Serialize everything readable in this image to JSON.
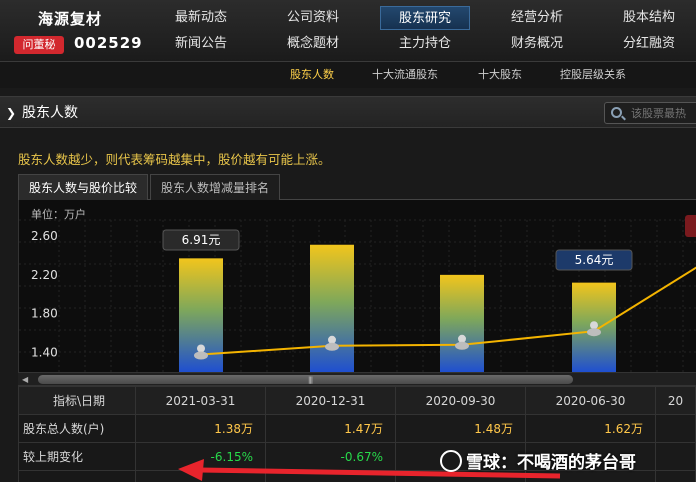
{
  "brand": {
    "name": "海源复材",
    "ask_label": "问董秘",
    "code": "002529"
  },
  "nav": [
    {
      "label": "最新动态"
    },
    {
      "label": "公司资料"
    },
    {
      "label": "股东研究"
    },
    {
      "label": "经营分析"
    },
    {
      "label": "股本结构"
    },
    {
      "label": "新闻公告"
    },
    {
      "label": "概念题材"
    },
    {
      "label": "主力持仓"
    },
    {
      "label": "财务概况"
    },
    {
      "label": "分红融资"
    }
  ],
  "subnav": [
    {
      "label": "股东人数"
    },
    {
      "label": "十大流通股东"
    },
    {
      "label": "十大股东"
    },
    {
      "label": "控股层级关系"
    }
  ],
  "section": {
    "title": "股东人数",
    "search_placeholder": "该股票最热"
  },
  "hint": "股东人数越少，则代表筹码越集中，股价越有可能上涨。",
  "tabs": [
    {
      "label": "股东人数与股价比较"
    },
    {
      "label": "股东人数增减量排名"
    }
  ],
  "chart_data": {
    "type": "bar",
    "unit_label": "单位：万户",
    "yticks": [
      "2.60",
      "2.20",
      "1.80",
      "1.40"
    ],
    "ylim": [
      1.2,
      2.6
    ],
    "bar_values": [
      2.37,
      2.51,
      2.2,
      2.12
    ],
    "line_values": [
      1.38,
      1.47,
      1.48,
      1.62
    ],
    "callouts": [
      {
        "index": 0,
        "text": "6.91元"
      },
      {
        "index": 3,
        "text": "5.64元"
      }
    ],
    "colors": {
      "bar_top": "#f2c51c",
      "bar_bottom": "#1f4fd0",
      "line": "#f4b400",
      "callout_bg": "#2a2a2a",
      "callout_active_bg": "#1d3a6a"
    }
  },
  "table": {
    "headers": [
      "指标\\日期",
      "2021-03-31",
      "2020-12-31",
      "2020-09-30",
      "2020-06-30",
      "20"
    ],
    "rows": [
      {
        "label": "股东总人数(户)",
        "values": [
          "1.38万",
          "1.47万",
          "1.48万",
          "1.62万"
        ],
        "tone": "yellow"
      },
      {
        "label": "较上期变化",
        "values": [
          "-6.15%",
          "-0.67%",
          "",
          ""
        ],
        "tone": "green"
      },
      {
        "label": "",
        "values": [
          "",
          "",
          "",
          ""
        ],
        "tone": "yellow"
      }
    ]
  },
  "watermark": {
    "text": "雪球：不喝酒的茅台哥"
  }
}
